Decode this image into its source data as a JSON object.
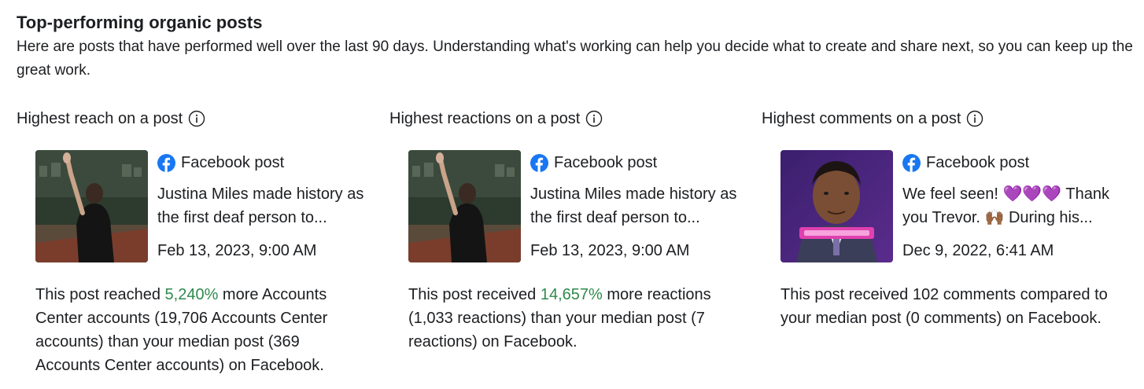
{
  "section": {
    "title": "Top-performing organic posts",
    "subtitle": "Here are posts that have performed well over the last 90 days. Understanding what's working can help you decide what to create and share next, so you can keep up the great work."
  },
  "columns": [
    {
      "heading": "Highest reach on a post",
      "post_type": "Facebook post",
      "caption": "Justina Miles made history as the first deaf person to...",
      "date": "Feb 13, 2023, 9:00 AM",
      "desc_before": "This post reached ",
      "desc_highlight": "5,240%",
      "desc_after": " more Accounts Center accounts (19,706 Accounts Center accounts) than your median post (369 Accounts Center accounts) on Facebook."
    },
    {
      "heading": "Highest reactions on a post",
      "post_type": "Facebook post",
      "caption": "Justina Miles made history as the first deaf person to...",
      "date": "Feb 13, 2023, 9:00 AM",
      "desc_before": "This post received ",
      "desc_highlight": "14,657%",
      "desc_after": " more reactions (1,033 reactions) than your median post (7 reactions) on Facebook."
    },
    {
      "heading": "Highest comments on a post",
      "post_type": "Facebook post",
      "caption": "We feel seen! 💜💜💜 Thank you Trevor. 🙌🏾 During his...",
      "date": "Dec 9, 2022, 6:41 AM",
      "desc_before": "This post received 102 comments compared to your median post (0 comments) on Facebook.",
      "desc_highlight": "",
      "desc_after": ""
    }
  ],
  "colors": {
    "facebook_blue": "#1877f2",
    "highlight_green": "#2e8a4d",
    "text": "#1c1e21"
  },
  "icons": {
    "info": "info-icon",
    "facebook": "facebook-logo-icon"
  }
}
